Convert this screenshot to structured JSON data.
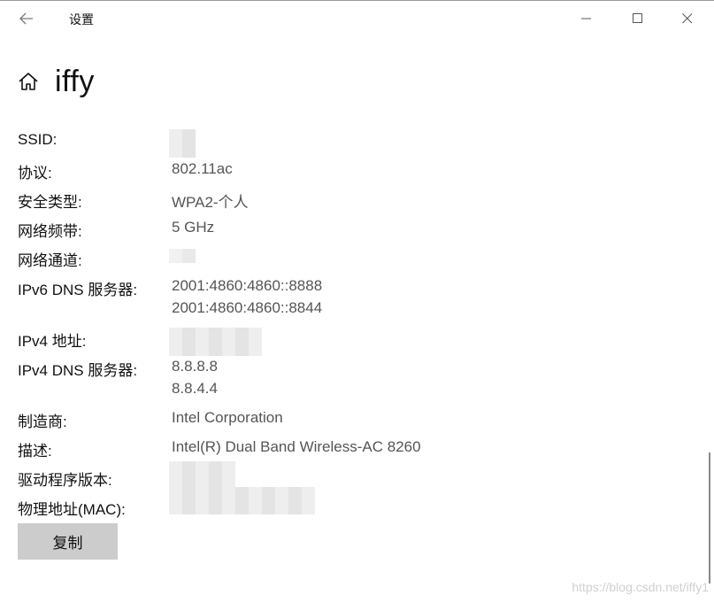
{
  "window": {
    "title": "设置",
    "icons": {
      "back": "back-arrow-icon",
      "minimize": "minimize-icon",
      "maximize": "maximize-icon",
      "close": "close-icon"
    }
  },
  "header": {
    "icon": "home-icon",
    "title": "iffy"
  },
  "properties": {
    "ssid": {
      "label": "SSID:",
      "value": ""
    },
    "protocol": {
      "label": "协议:",
      "value": "802.11ac"
    },
    "security": {
      "label": "安全类型:",
      "value": "WPA2-个人"
    },
    "band": {
      "label": "网络频带:",
      "value": "5 GHz"
    },
    "channel": {
      "label": "网络通道:",
      "value": ""
    },
    "ipv6_dns": {
      "label": "IPv6 DNS 服务器:",
      "values": [
        "2001:4860:4860::8888",
        "2001:4860:4860::8844"
      ]
    },
    "ipv4": {
      "label": "IPv4 地址:",
      "value": ""
    },
    "ipv4_dns": {
      "label": "IPv4 DNS 服务器:",
      "values": [
        "8.8.8.8",
        "8.8.4.4"
      ]
    },
    "manufacturer": {
      "label": "制造商:",
      "value": "Intel Corporation"
    },
    "description": {
      "label": "描述:",
      "value": "Intel(R) Dual Band Wireless-AC 8260"
    },
    "driver_version": {
      "label": "驱动程序版本:",
      "value": ""
    },
    "mac": {
      "label": "物理地址(MAC):",
      "value": ""
    }
  },
  "actions": {
    "copy_label": "复制"
  },
  "watermark": "https://blog.csdn.net/iffy1",
  "colors": {
    "button_bg": "#cccccc",
    "value_text": "#555555",
    "label_text": "#111111"
  }
}
